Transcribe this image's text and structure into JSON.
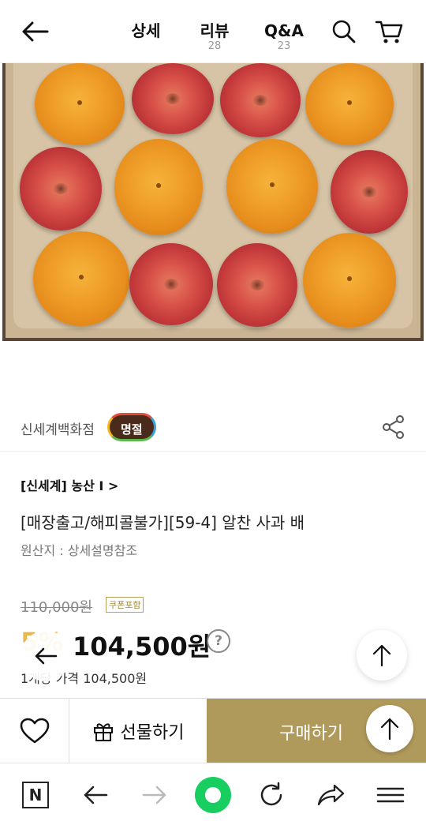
{
  "header": {
    "tabs": [
      {
        "label": "상세",
        "count": ""
      },
      {
        "label": "리뷰",
        "count": "28"
      },
      {
        "label": "Q&A",
        "count": "23"
      }
    ]
  },
  "store": {
    "name": "신세계백화점",
    "badge": "명절"
  },
  "product": {
    "brand_link": "[신세계] 농산 I >",
    "title": "[매장출고/해피콜불가][59-4] 알찬 사과 배",
    "origin": "원산지 : 상세설명참조",
    "original_price": "110,000원",
    "coupon_badge": "쿠폰포함",
    "discount": "5%",
    "sale_price": "104,500원",
    "help_symbol": "?",
    "unit_price": "1개당 가격 104,500원"
  },
  "purchase_bar": {
    "gift_label": "선물하기",
    "buy_label": "구매하기"
  },
  "colors": {
    "buy_button": "#b09a5b",
    "discount": "#e8b84a",
    "badge_bg": "#4a2a1a"
  },
  "icons": [
    "back-arrow-icon",
    "search-icon",
    "cart-icon",
    "share-icon",
    "heart-icon",
    "gift-icon",
    "arrow-up-icon",
    "naver-n-icon",
    "browser-back-icon",
    "browser-forward-icon",
    "home-green-icon",
    "refresh-icon",
    "share-arrow-icon",
    "menu-icon"
  ]
}
